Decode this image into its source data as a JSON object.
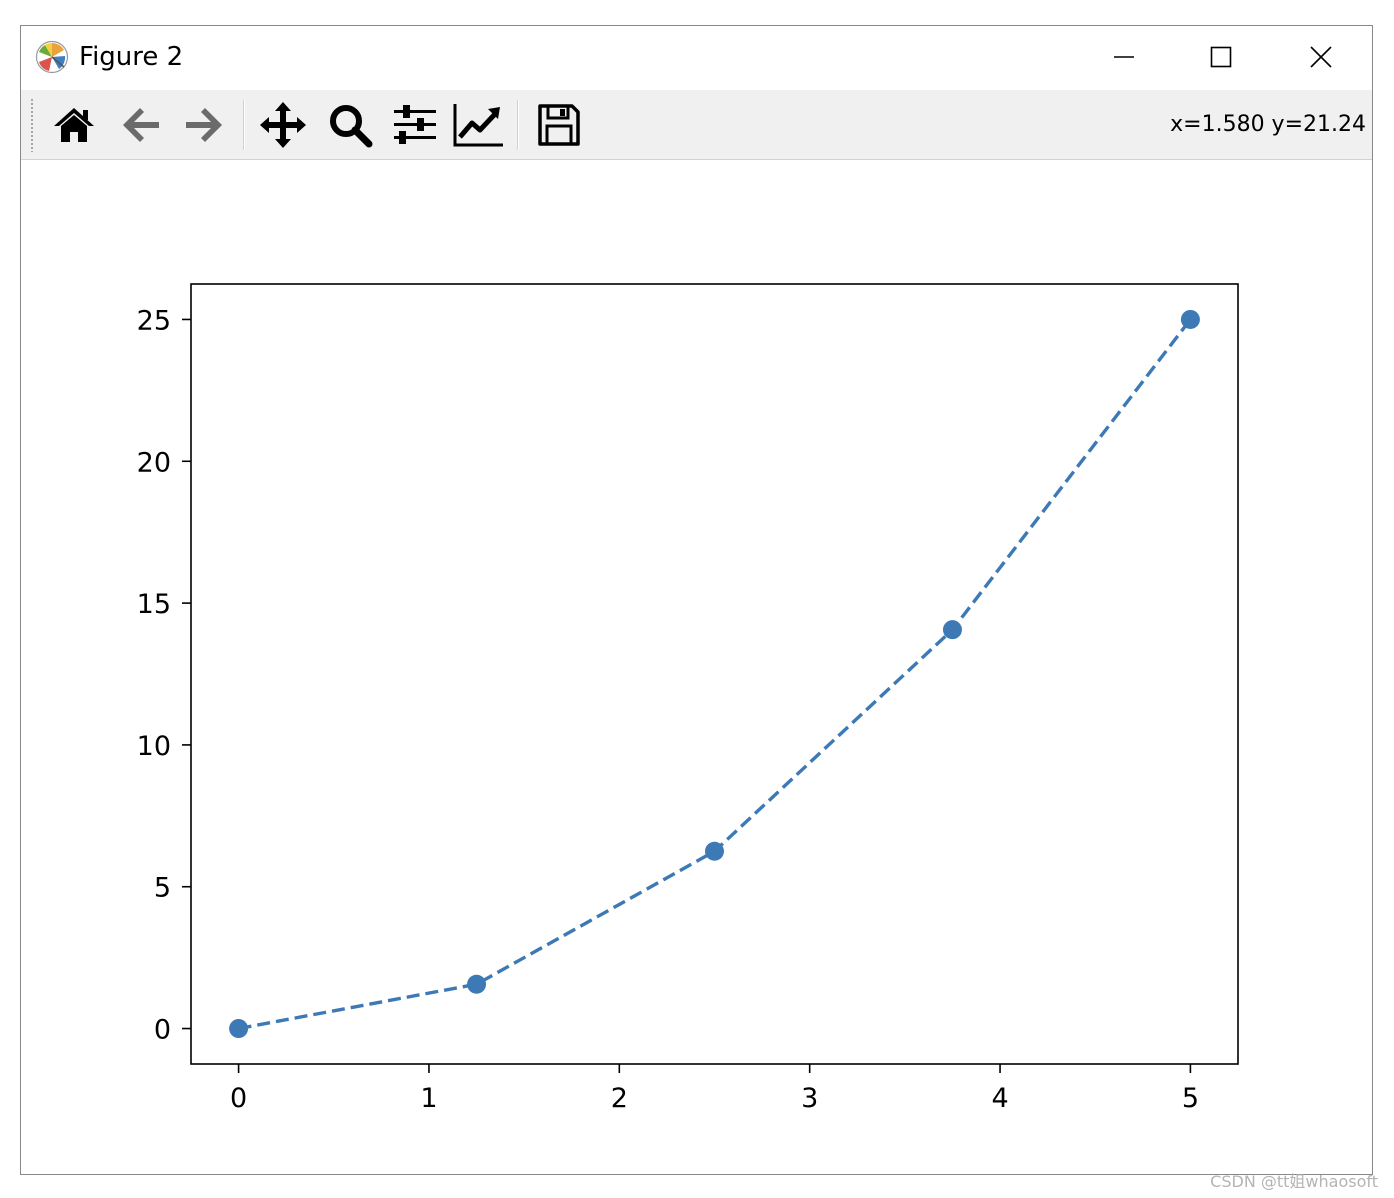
{
  "window": {
    "title": "Figure 2",
    "controls": {
      "minimize": "minimize-icon",
      "maximize": "maximize-icon",
      "close": "close-icon"
    }
  },
  "toolbar": {
    "buttons": [
      {
        "id": "home",
        "icon": "home-icon"
      },
      {
        "id": "back",
        "icon": "arrow-left-icon"
      },
      {
        "id": "forward",
        "icon": "arrow-right-icon"
      },
      {
        "id": "pan",
        "icon": "move-icon"
      },
      {
        "id": "zoom",
        "icon": "magnifier-icon"
      },
      {
        "id": "configure",
        "icon": "sliders-icon"
      },
      {
        "id": "edit-axes",
        "icon": "line-chart-icon"
      },
      {
        "id": "save",
        "icon": "floppy-disk-icon"
      }
    ],
    "coordinates": "x=1.580 y=21.24"
  },
  "chart_data": {
    "type": "line",
    "title": "",
    "xlabel": "",
    "ylabel": "",
    "x": [
      0,
      1.25,
      2.5,
      3.75,
      5
    ],
    "series": [
      {
        "values": [
          0,
          1.5625,
          6.25,
          14.0625,
          25
        ],
        "color": "#3d7ab5",
        "linestyle": "dashed",
        "marker": "circle"
      }
    ],
    "xlim": [
      -0.25,
      5.25
    ],
    "ylim": [
      -1.25,
      26.25
    ],
    "xticks": [
      0,
      1,
      2,
      3,
      4,
      5
    ],
    "xtick_labels": [
      "0",
      "1",
      "2",
      "3",
      "4",
      "5"
    ],
    "yticks": [
      0,
      5,
      10,
      15,
      20,
      25
    ],
    "ytick_labels": [
      "0",
      "5",
      "10",
      "15",
      "20",
      "25"
    ],
    "grid": false,
    "legend": "none"
  },
  "watermark": "CSDN @tt姐whaosoft"
}
